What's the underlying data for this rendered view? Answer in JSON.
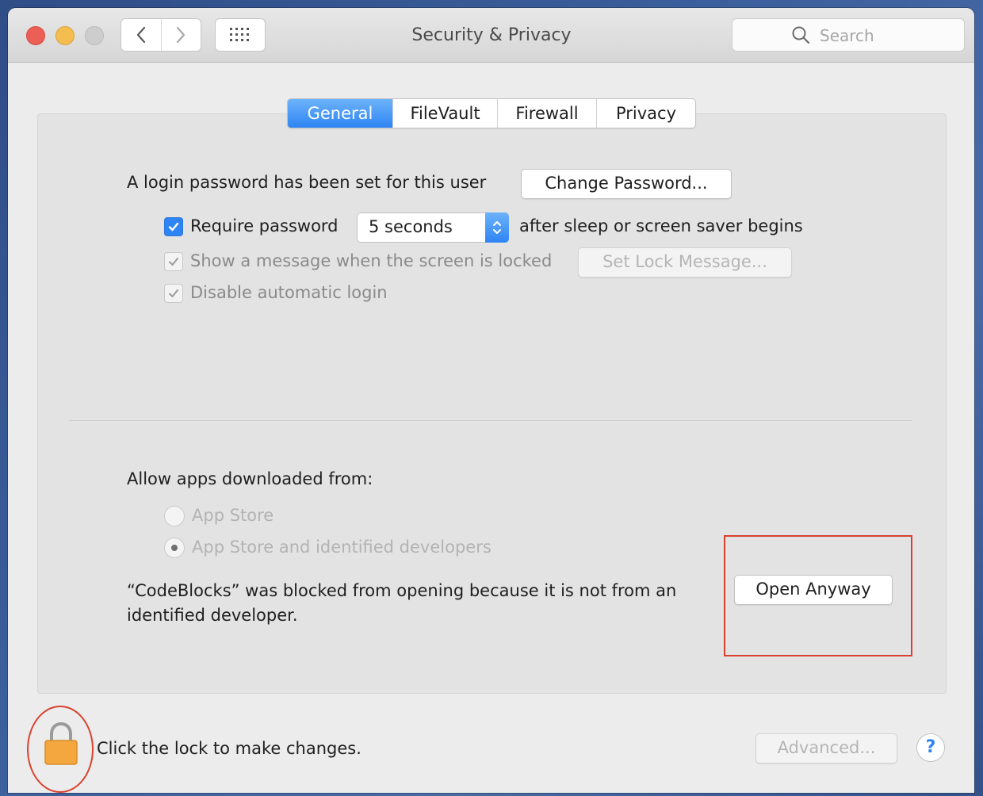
{
  "window": {
    "title": "Security & Privacy",
    "search": {
      "placeholder": "Search"
    }
  },
  "tabs": [
    {
      "label": "General",
      "active": true
    },
    {
      "label": "FileVault",
      "active": false
    },
    {
      "label": "Firewall",
      "active": false
    },
    {
      "label": "Privacy",
      "active": false
    }
  ],
  "general": {
    "login_password_text": "A login password has been set for this user",
    "change_password_label": "Change Password...",
    "require_password_label": "Require password",
    "require_password_checked": true,
    "require_password_delay": "5 seconds",
    "after_sleep_text": "after sleep or screen saver begins",
    "show_message_label": "Show a message when the screen is locked",
    "show_message_checked": true,
    "set_lock_message_label": "Set Lock Message...",
    "disable_auto_login_label": "Disable automatic login",
    "disable_auto_login_checked": true
  },
  "downloads": {
    "heading": "Allow apps downloaded from:",
    "options": [
      {
        "label": "App Store",
        "selected": false
      },
      {
        "label": "App Store and identified developers",
        "selected": true
      }
    ],
    "blocked_message_line1": "“CodeBlocks” was blocked from opening because it is not from an",
    "blocked_message_line2": "identified developer.",
    "open_anyway_label": "Open Anyway"
  },
  "footer": {
    "lock_text": "Click the lock to make changes.",
    "advanced_label": "Advanced...",
    "help_label": "?"
  },
  "colors": {
    "accent": "#2f84f4",
    "annotation": "#d9412f",
    "lock": "#f3a73e"
  }
}
